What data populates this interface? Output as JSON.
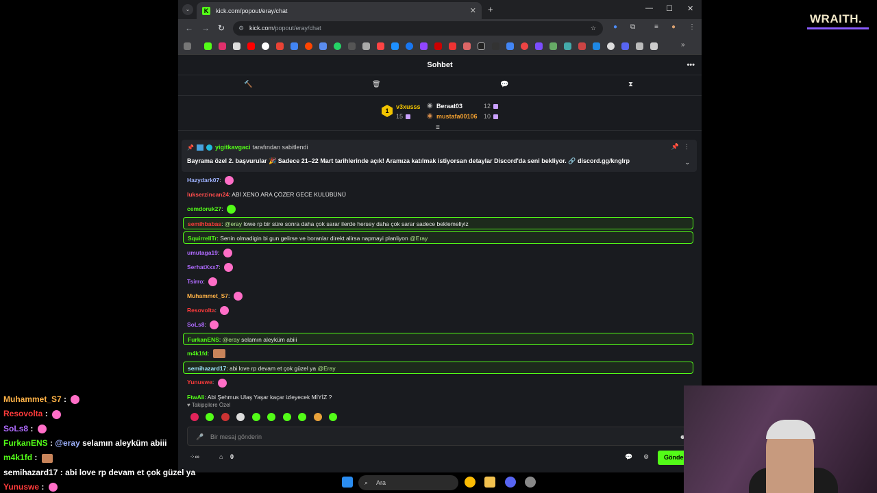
{
  "browser": {
    "tab_title": "kick.com/popout/eray/chat",
    "url_host": "kick.com",
    "url_path": "/popout/eray/chat",
    "tab_favicon": "K"
  },
  "chat": {
    "header_title": "Sohbet",
    "leaderboard": {
      "rank": "1",
      "first_user": "v3xusss",
      "first_count": "15",
      "second_user": "Beraat03",
      "second_count": "12",
      "third_user": "mustafa00106",
      "third_count": "10"
    },
    "pinned": {
      "pinned_by_user": "yigitkavgaci",
      "pinned_by_suffix": "tarafından sabitlendi",
      "text": "Bayrama özel 2. başvurular 🎉 Sadece 21–22 Mart tarihlerinde açık! Aramıza katılmak istiyorsan detaylar Discord'da seni bekliyor. 🔗 discord.gg/knglrp"
    },
    "messages": [
      {
        "user": "Hazydark07",
        "text": "",
        "color": "#9fb3ff"
      },
      {
        "user": "lukserzincan24",
        "text": "ABİ XENO ARA ÇÖZER GECE KULÜBÜNÜ",
        "color": "#ff4d4d"
      },
      {
        "user": "cemdoruk27",
        "text": "",
        "color": "#53fc18"
      },
      {
        "user": "semihbabas",
        "mention": "@eray",
        "text": " lowe rp bir süre sonra daha çok sarar ilerde hersey daha çok sarar sadece beklemeliyiz",
        "color": "#ff3b3b"
      },
      {
        "user": "SquirrelITr",
        "text": "Senin olmadigin bi gun gelirse ve boranlar direkt alirsa napmayi planliyon ",
        "mention": "@Eray",
        "color": "#53fc18"
      },
      {
        "user": "umutaga19",
        "text": "",
        "color": "#b06bff"
      },
      {
        "user": "SerhatXxx7",
        "text": "",
        "color": "#b06bff"
      },
      {
        "user": "Tsirro",
        "text": "",
        "color": "#b06bff"
      },
      {
        "user": "Muhammet_S7",
        "text": "",
        "color": "#ffb347"
      },
      {
        "user": "Resovolta",
        "text": "",
        "color": "#ff3b3b"
      },
      {
        "user": "SoLs8",
        "text": "",
        "color": "#b06bff"
      },
      {
        "user": "FurkanENS",
        "mention": "@eray",
        "text": " selamın aleyküm abiii",
        "color": "#53fc18"
      },
      {
        "user": "m4k1fd",
        "text": "",
        "color": "#53fc18"
      },
      {
        "user": "semihazard17",
        "text": "abi love rp devam et çok güzel ya ",
        "mention": "@Eray",
        "color": "#9fe6ff"
      },
      {
        "user": "Yunuswe",
        "text": "",
        "color": "#ff3b3b"
      },
      {
        "user": "FtwAli",
        "text": "Abi Şehmus Ulaş Yaşar kaçar izleyecek MİYİZ ?",
        "color": "#53fc18"
      }
    ],
    "emote_section_label": "Takipçilere Özel",
    "input_placeholder": "Bir mesaj gönderin",
    "points": "0",
    "send_label": "Gönder"
  },
  "overlay": {
    "brand": "WRAITH.",
    "lines": [
      {
        "user": "Muhammet_S7",
        "text": "",
        "color": "#ffb347"
      },
      {
        "user": "Resovolta",
        "text": "",
        "color": "#ff3b3b"
      },
      {
        "user": "SoLs8",
        "text": "",
        "color": "#b06bff"
      },
      {
        "user": "FurkanENS",
        "mention": "@eray",
        "text": " selamın aleyküm abiii",
        "color": "#53fc18"
      },
      {
        "user": "m4k1fd",
        "text": "",
        "color": "#53fc18"
      },
      {
        "user": "semihazard17",
        "text": " abi love rp devam et çok güzel ya",
        "color": "#ffffff"
      },
      {
        "user": "Yunuswe",
        "text": "",
        "color": "#ff3b3b"
      }
    ]
  },
  "taskbar": {
    "search_label": "Ara"
  },
  "colors": {
    "accent": "#53fc18",
    "chat_bg": "#191b1f"
  }
}
